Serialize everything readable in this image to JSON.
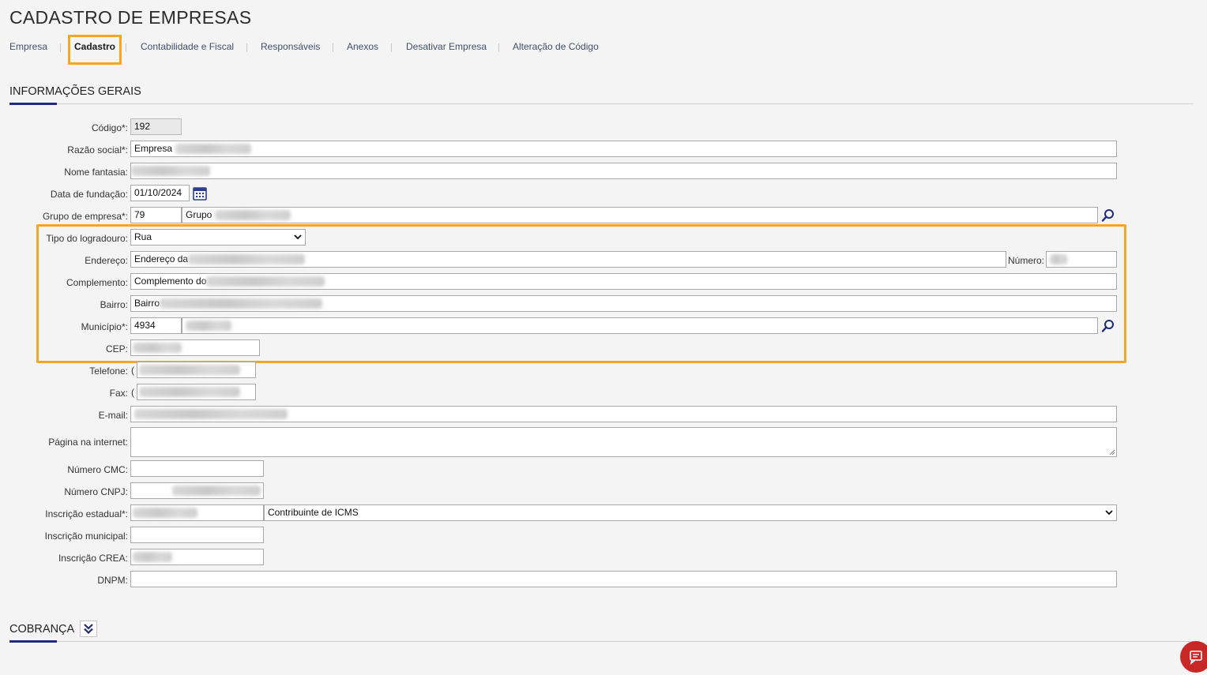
{
  "page": {
    "title": "CADASTRO DE EMPRESAS"
  },
  "tabs": [
    {
      "label": "Empresa"
    },
    {
      "label": "Cadastro"
    },
    {
      "label": "Contabilidade e Fiscal"
    },
    {
      "label": "Responsáveis"
    },
    {
      "label": "Anexos"
    },
    {
      "label": "Desativar Empresa"
    },
    {
      "label": "Alteração de Código"
    }
  ],
  "sections": {
    "general": "INFORMAÇÕES GERAIS",
    "billing": "COBRANÇA"
  },
  "form": {
    "codigo": {
      "label": "Código*:",
      "value": "192"
    },
    "razao_social": {
      "label": "Razão social*:",
      "value": "Empresa"
    },
    "nome_fantasia": {
      "label": "Nome fantasia:",
      "value": ""
    },
    "data_fundacao": {
      "label": "Data de fundação:",
      "value": "01/10/2024"
    },
    "grupo_empresa": {
      "label": "Grupo de empresa*:",
      "code": "79",
      "name": "Grupo"
    },
    "tipo_logradouro": {
      "label": "Tipo do logradouro:",
      "value": "Rua"
    },
    "endereco": {
      "label": "Endereço:",
      "value": "Endereço da"
    },
    "numero": {
      "label": "Número:",
      "value": ""
    },
    "complemento": {
      "label": "Complemento:",
      "value": "Complemento do"
    },
    "bairro": {
      "label": "Bairro:",
      "value": "Bairro"
    },
    "municipio": {
      "label": "Município*:",
      "code": "4934",
      "name": ""
    },
    "cep": {
      "label": "CEP:",
      "value": ""
    },
    "telefone": {
      "label": "Telefone:",
      "value": "("
    },
    "fax": {
      "label": "Fax:",
      "value": "("
    },
    "email": {
      "label": "E-mail:",
      "value": ""
    },
    "pagina_internet": {
      "label": "Página na internet:",
      "value": ""
    },
    "numero_cmc": {
      "label": "Número CMC:",
      "value": ""
    },
    "numero_cnpj": {
      "label": "Número CNPJ:",
      "value": ""
    },
    "inscricao_estadual": {
      "label": "Inscrição estadual*:",
      "value": "",
      "tipo": "Contribuinte de ICMS"
    },
    "inscricao_municipal": {
      "label": "Inscrição municipal:",
      "value": ""
    },
    "inscricao_crea": {
      "label": "Inscrição CREA:",
      "value": ""
    },
    "dnpm": {
      "label": "DNPM:",
      "value": ""
    }
  },
  "icons": {
    "calendar": "calendar-icon",
    "search": "search-icon",
    "collapse": "double-chevron-down-icon",
    "chat": "chat-icon"
  },
  "colors": {
    "highlight": "#f5a623",
    "accent": "#1f2a7a",
    "chat": "#c62828"
  }
}
